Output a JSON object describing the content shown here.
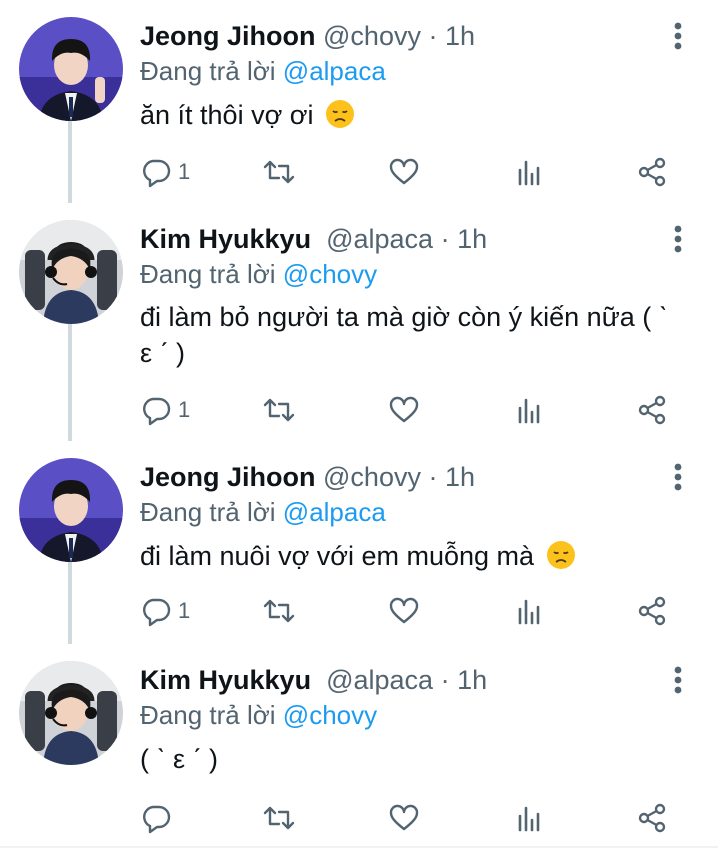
{
  "colors": {
    "accent": "#1d9bf0",
    "secondary": "#536471",
    "text": "#0f1419",
    "thread_line": "#cfd9de"
  },
  "tweets": [
    {
      "name": "Jeong Jihoon",
      "handle": "@chovy",
      "sep": "·",
      "time": "1h",
      "reply_prefix": "Đang trả lời",
      "reply_to": "@alpaca",
      "text": "ăn ít thôi vợ ơi",
      "emoji": "disappointed-face-icon",
      "reply_count": "1"
    },
    {
      "name": "Kim Hyukkyu",
      "handle": "@alpaca",
      "sep": "·",
      "time": "1h",
      "reply_prefix": "Đang trả lời",
      "reply_to": "@chovy",
      "text": "đi làm bỏ người ta mà giờ còn ý kiến nữa ( ˋ ε ˊ )",
      "emoji": "",
      "reply_count": "1"
    },
    {
      "name": "Jeong Jihoon",
      "handle": "@chovy",
      "sep": "·",
      "time": "1h",
      "reply_prefix": "Đang trả lời",
      "reply_to": "@alpaca",
      "text": "đi làm nuôi vợ với em muỗng mà",
      "emoji": "disappointed-face-icon",
      "reply_count": "1"
    },
    {
      "name": "Kim Hyukkyu",
      "handle": "@alpaca",
      "sep": "·",
      "time": "1h",
      "reply_prefix": "Đang trả lời",
      "reply_to": "@chovy",
      "text": "( ˋ ε ˊ )",
      "emoji": "",
      "reply_count": ""
    }
  ]
}
